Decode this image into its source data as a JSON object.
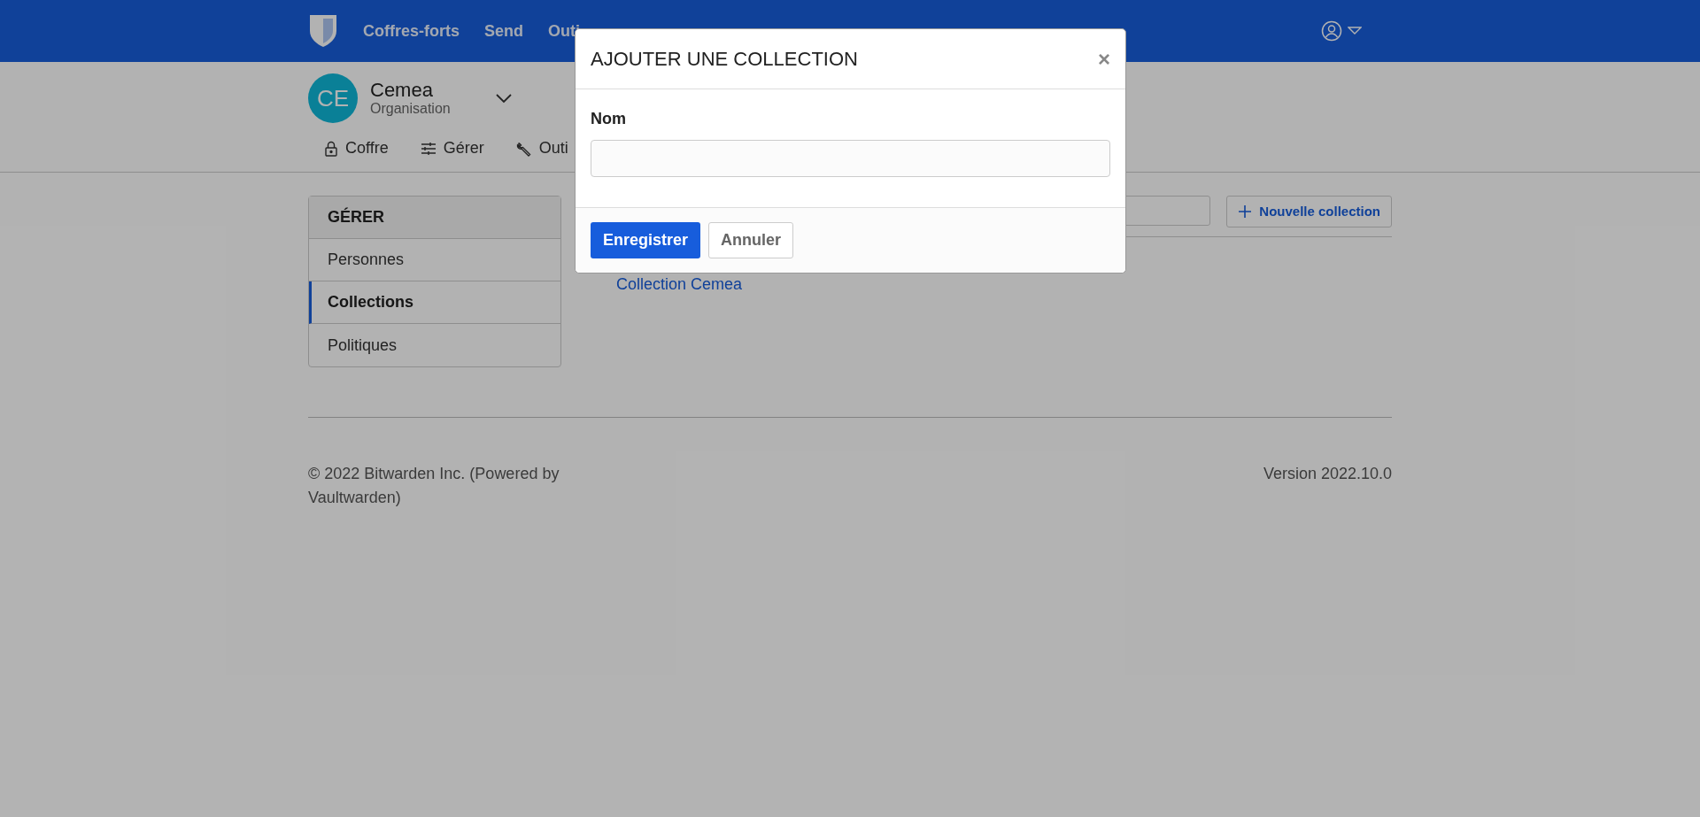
{
  "navbar": {
    "items": [
      {
        "label": "Coffres-forts"
      },
      {
        "label": "Send"
      },
      {
        "label": "Outi"
      }
    ]
  },
  "organization": {
    "initials": "CE",
    "name": "Cemea",
    "subtitle": "Organisation"
  },
  "org_tabs": [
    {
      "label": "Coffre"
    },
    {
      "label": "Gérer"
    },
    {
      "label": "Outi"
    }
  ],
  "sidebar": {
    "title": "GÉRER",
    "items": [
      {
        "label": "Personnes",
        "selected": false
      },
      {
        "label": "Collections",
        "selected": true
      },
      {
        "label": "Politiques",
        "selected": false
      }
    ]
  },
  "content": {
    "new_button": "Nouvelle collection",
    "collections": [
      "Collection Cemea"
    ]
  },
  "footer": {
    "copyright": "© 2022 Bitwarden Inc. (Powered by Vaultwarden)",
    "version": "Version 2022.10.0"
  },
  "modal": {
    "title": "AJOUTER UNE COLLECTION",
    "close": "×",
    "field_label": "Nom",
    "save": "Enregistrer",
    "cancel": "Annuler"
  }
}
